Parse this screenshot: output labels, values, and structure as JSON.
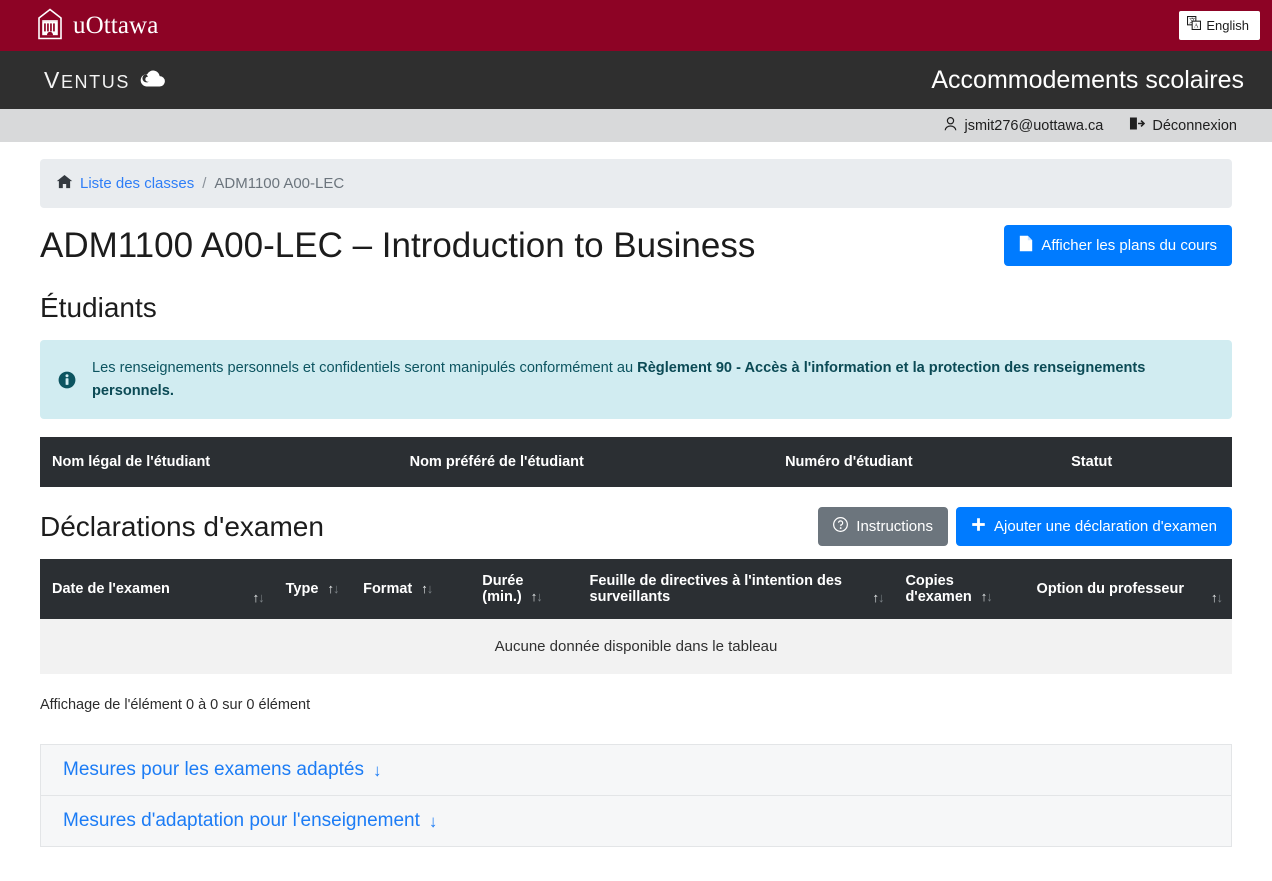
{
  "brand": {
    "university": "uOttawa",
    "app_name": "Ventus",
    "app_title": "Accommodements scolaires",
    "language_button": "English",
    "colors": {
      "uottawa_red": "#8d0325",
      "dark_bar": "#2f2f2f",
      "primary_blue": "#007bff",
      "link_blue": "#1c7cf5",
      "info_bg": "#d1ecf1",
      "table_header": "#2b2f33"
    }
  },
  "user_bar": {
    "email": "jsmit276@uottawa.ca",
    "logout_label": "Déconnexion"
  },
  "breadcrumb": {
    "home_link": "Liste des classes",
    "separator": "/",
    "current": "ADM1100 A00-LEC"
  },
  "page": {
    "title": "ADM1100 A00-LEC – Introduction to Business",
    "course_outlines_button": "Afficher les plans du cours"
  },
  "students_section": {
    "heading": "Étudiants",
    "notice_plain": "Les renseignements personnels et confidentiels seront manipulés conformément au ",
    "notice_bold": "Règlement 90 - Accès à l'information et la protection des renseignements personnels.",
    "columns": [
      "Nom légal de l'étudiant",
      "Nom préféré de l'étudiant",
      "Numéro d'étudiant",
      "Statut"
    ],
    "rows": []
  },
  "exam_section": {
    "heading": "Déclarations d'examen",
    "instructions_button": "Instructions",
    "add_button": "Ajouter une déclaration d'examen",
    "columns": [
      "Date de l'examen",
      "Type",
      "Format",
      "Durée (min.)",
      "Feuille de directives à l'intention des surveillants",
      "Copies d'examen",
      "Option du professeur"
    ],
    "empty_message": "Aucune donnée disponible dans le tableau",
    "info_text": "Affichage de l'élément 0 à 0 sur 0 élément",
    "rows": []
  },
  "accordion": {
    "items": [
      {
        "label": "Mesures pour les examens adaptés",
        "arrow": "↓"
      },
      {
        "label": "Mesures d'adaptation pour l'enseignement",
        "arrow": "↓"
      }
    ]
  }
}
